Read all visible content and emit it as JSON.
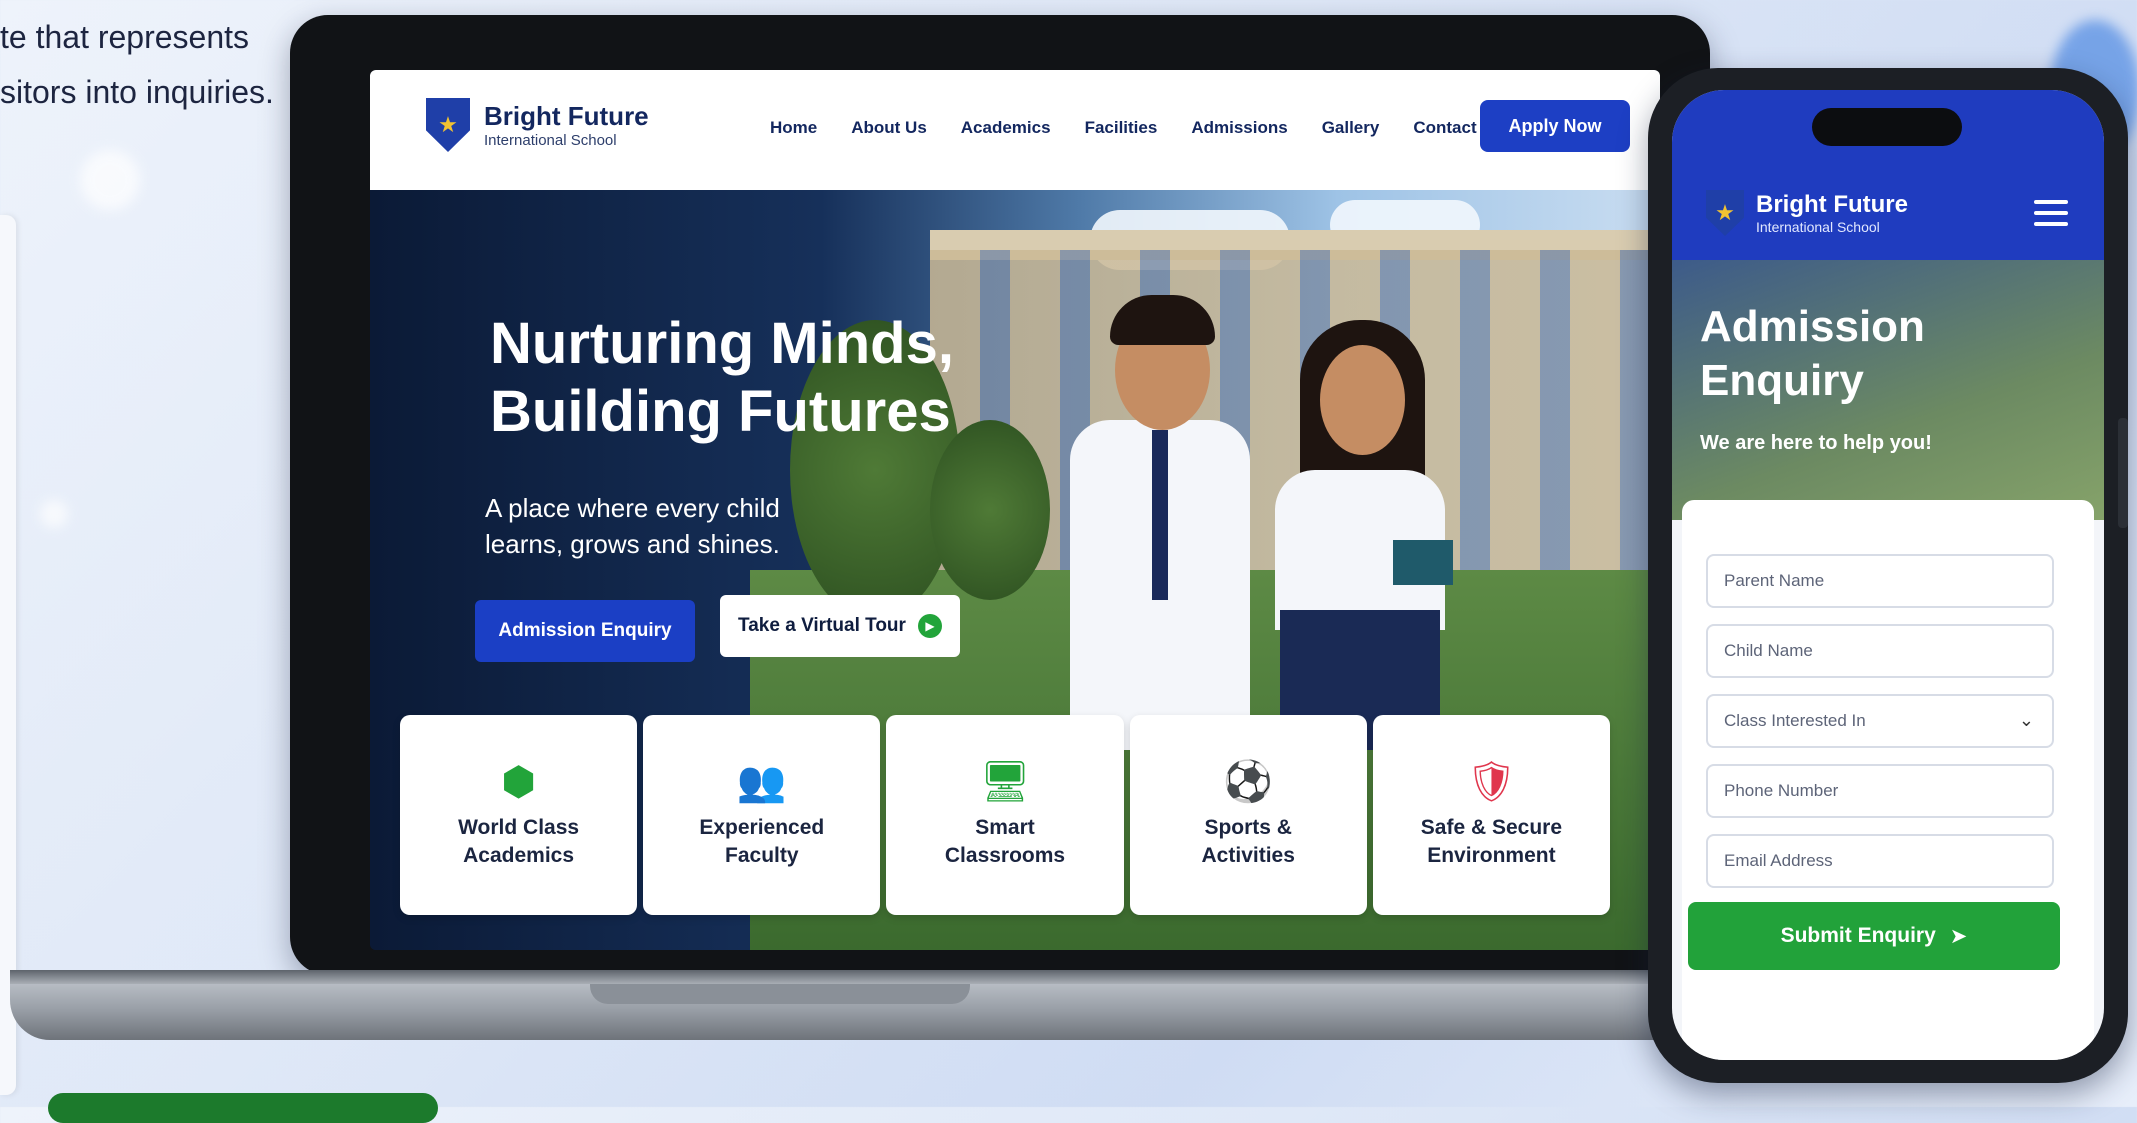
{
  "caption": {
    "line1": "te that represents",
    "line2": "sitors into inquiries."
  },
  "site": {
    "brand_name": "Bright Future",
    "brand_sub": "International School",
    "nav": [
      "Home",
      "About Us",
      "Academics",
      "Facilities",
      "Admissions",
      "Gallery",
      "Contact"
    ],
    "apply_label": "Apply Now",
    "hero_title_1": "Nurturing Minds,",
    "hero_title_2": "Building Futures",
    "hero_sub_1": "A place where every child",
    "hero_sub_2": "learns, grows and shines.",
    "btn_enquiry": "Admission Enquiry",
    "btn_tour": "Take a Virtual Tour",
    "features": [
      {
        "icon": "cube-icon",
        "glyph": "⬢",
        "label": "World Class Academics",
        "color": "#22a43a"
      },
      {
        "icon": "faculty-icon",
        "glyph": "👥",
        "label": "Experienced Faculty",
        "color": "#1f3fc4"
      },
      {
        "icon": "smartboard-icon",
        "glyph": "🖥",
        "label": "Smart Classrooms",
        "color": "#22a43a"
      },
      {
        "icon": "sports-icon",
        "glyph": "⚽",
        "label": "Sports & Activities",
        "color": "#d33b3b"
      },
      {
        "icon": "shield-check-icon",
        "glyph": "🛡",
        "label": "Safe & Secure Environment",
        "color": "#e0364d"
      }
    ]
  },
  "phone": {
    "brand_name": "Bright Future",
    "brand_sub": "International School",
    "title_1": "Admission",
    "title_2": "Enquiry",
    "subtitle": "We are here to help you!",
    "fields": [
      {
        "placeholder": "Parent Name",
        "type": "text"
      },
      {
        "placeholder": "Child Name",
        "type": "text"
      },
      {
        "placeholder": "Class Interested In",
        "type": "select"
      },
      {
        "placeholder": "Phone Number",
        "type": "text"
      },
      {
        "placeholder": "Email Address",
        "type": "text"
      }
    ],
    "submit_label": "Submit Enquiry"
  },
  "colors": {
    "primary_blue": "#1d3fc4",
    "accent_green": "#22a23a",
    "navy": "#13275f"
  }
}
